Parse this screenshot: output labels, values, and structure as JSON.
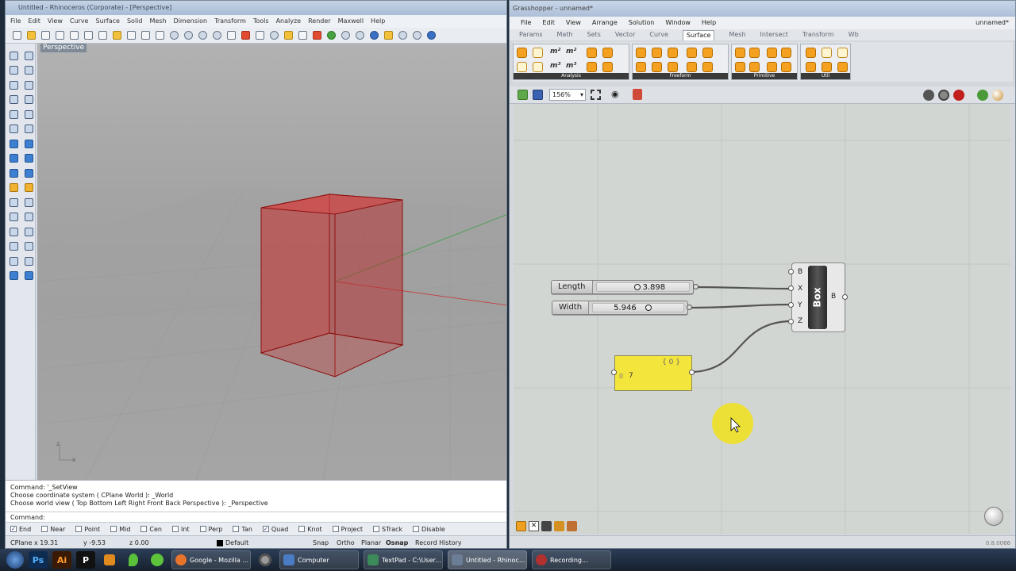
{
  "rhino": {
    "title": "Untitled - Rhinoceros (Corporate) - [Perspective]",
    "menu": [
      "File",
      "Edit",
      "View",
      "Curve",
      "Surface",
      "Solid",
      "Mesh",
      "Dimension",
      "Transform",
      "Tools",
      "Analyze",
      "Render",
      "Maxwell",
      "Help"
    ],
    "viewport_label": "Perspective",
    "command_history": [
      "Command: '_SetView",
      "Choose coordinate system ( CPlane  World ): _World",
      "Choose world view ( Top  Bottom  Left  Right  Front  Back  Perspective ): _Perspective"
    ],
    "command_prompt": "Command:",
    "osnaps": [
      {
        "label": "End",
        "checked": true
      },
      {
        "label": "Near",
        "checked": false
      },
      {
        "label": "Point",
        "checked": false
      },
      {
        "label": "Mid",
        "checked": false
      },
      {
        "label": "Cen",
        "checked": false
      },
      {
        "label": "Int",
        "checked": false
      },
      {
        "label": "Perp",
        "checked": false
      },
      {
        "label": "Tan",
        "checked": false
      },
      {
        "label": "Quad",
        "checked": true
      },
      {
        "label": "Knot",
        "checked": false
      },
      {
        "label": "Project",
        "checked": false
      },
      {
        "label": "STrack",
        "checked": false
      },
      {
        "label": "Disable",
        "checked": false
      }
    ],
    "status": {
      "cplane": "CPlane",
      "x": "x 19.31",
      "y": "y -9.53",
      "z": "z 0.00",
      "layer": "Default",
      "toggles": [
        "Snap",
        "Ortho",
        "Planar",
        "Osnap",
        "Record History"
      ]
    },
    "axis_x_label": "x",
    "axis_z_label": "z"
  },
  "grasshopper": {
    "title": "Grasshopper - unnamed*",
    "document_name": "unnamed*",
    "menu": [
      "File",
      "Edit",
      "View",
      "Arrange",
      "Solution",
      "Window",
      "Help"
    ],
    "tabs": [
      "Params",
      "Math",
      "Sets",
      "Vector",
      "Curve",
      "Surface",
      "Mesh",
      "Intersect",
      "Transform",
      "Wb"
    ],
    "active_tab": "Surface",
    "ribbon_groups": [
      "Analysis",
      "Freeform",
      "Primitive",
      "Util"
    ],
    "zoom": "156%",
    "sliders": [
      {
        "label": "Length",
        "value": "3.898"
      },
      {
        "label": "Width",
        "value": "5.946"
      }
    ],
    "box_component": {
      "name": "Box",
      "inputs": [
        "B",
        "X",
        "Y",
        "Z"
      ],
      "output": "B"
    },
    "panel": {
      "header": "{ 0 }",
      "index": "0",
      "value": "7"
    },
    "status_value": "0.8.0066",
    "colors": {
      "panel": "#f4e53c",
      "cursor_highlight": "#f1e21c",
      "box_fill": "#c92a2a"
    }
  },
  "taskbar": {
    "apps": [
      "Ps",
      "Ai",
      "P"
    ],
    "tasks": [
      {
        "label": "Google - Mozilla ...",
        "color": "#e8732a"
      },
      {
        "label": "Computer",
        "color": "#4a7cc4"
      },
      {
        "label": "TextPad - C:\\User...",
        "color": "#3c8a5a"
      },
      {
        "label": "Untitled - Rhinoc...",
        "color": "#6b7e96"
      },
      {
        "label": "Recording...",
        "color": "#b23030"
      }
    ]
  }
}
